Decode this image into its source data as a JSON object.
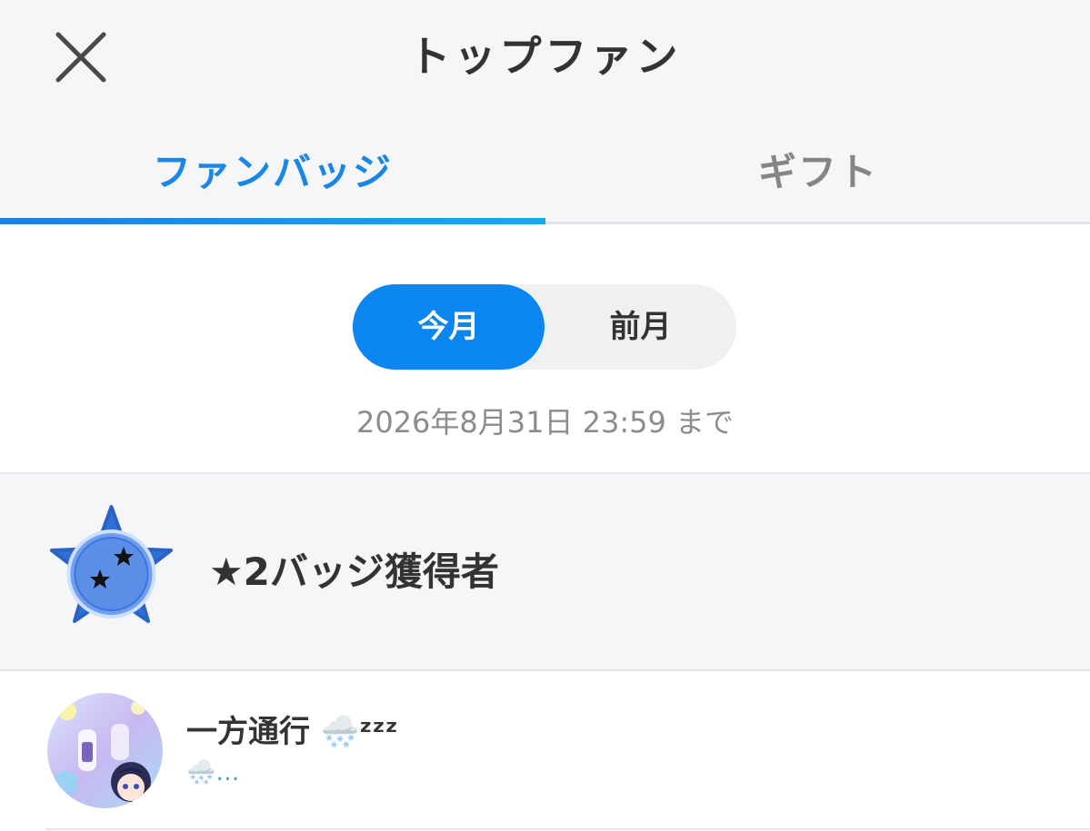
{
  "header": {
    "title": "トップファン"
  },
  "tabs": [
    {
      "label": "ファンバッジ",
      "active": true
    },
    {
      "label": "ギフト",
      "active": false
    }
  ],
  "period_toggle": {
    "options": [
      "今月",
      "前月"
    ],
    "selected": "今月"
  },
  "deadline_text": "2026年8月31日 23:59 まで",
  "section": {
    "title": "★2バッジ獲得者",
    "badge_icon": "blue-star-badge-icon"
  },
  "fans": [
    {
      "name": "一方通行 🌨️ᶻᶻᶻ",
      "subtitle": "🌨️…",
      "avatar_icon": "anime-avatar-icon"
    }
  ],
  "colors": {
    "accent": "#1b86e6",
    "toggle_active": "#0b86f0",
    "header_bg": "#f5f6f8",
    "inactive_tab": "#858585",
    "deadline_text": "#8c8c8c"
  }
}
